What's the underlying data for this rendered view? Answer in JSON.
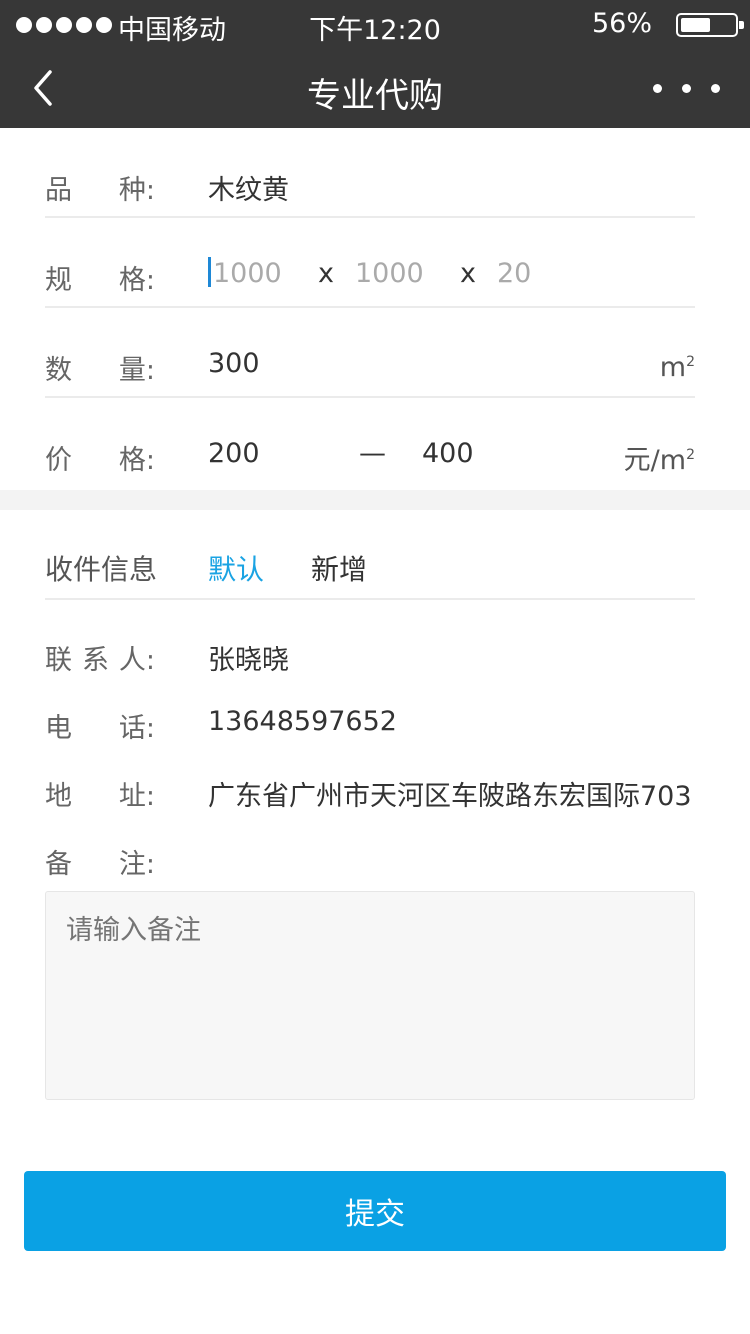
{
  "status_bar": {
    "carrier": "中国移动",
    "time": "下午12:20",
    "battery": "56%",
    "battery_level": 0.56
  },
  "nav": {
    "title": "专业代购",
    "back_icon": "chevron-left-icon",
    "more_icon": "more-horizontal-icon"
  },
  "form": {
    "variety": {
      "label_a": "品",
      "label_b": "种:",
      "value": "木纹黄"
    },
    "spec": {
      "label_a": "规",
      "label_b": "格:",
      "length_placeholder": "1000",
      "width_placeholder": "1000",
      "thickness_placeholder": "20",
      "separator": "x"
    },
    "quantity": {
      "label_a": "数",
      "label_b": "量:",
      "value": "300",
      "unit": "m",
      "unit_sup": "2"
    },
    "price": {
      "label_a": "价",
      "label_b": "格:",
      "min": "200",
      "dash": "—",
      "max": "400",
      "unit": "元/m",
      "unit_sup": "2"
    }
  },
  "receiver": {
    "heading": "收件信息",
    "tab_default": "默认",
    "tab_new": "新增",
    "contact": {
      "label_a": "联",
      "label_b": "系",
      "label_c": "人:",
      "value": "张晓晓"
    },
    "phone": {
      "label_a": "电",
      "label_b": "话:",
      "value": "13648597652"
    },
    "address": {
      "label_a": "地",
      "label_b": "址:",
      "value": "广东省广州市天河区车陂路东宏国际703"
    },
    "note": {
      "label_a": "备",
      "label_b": "注:",
      "placeholder": "请输入备注"
    }
  },
  "submit_label": "提交",
  "colors": {
    "header_bg": "#373737",
    "accent": "#1aa3e3",
    "button": "#0aa1e4"
  }
}
